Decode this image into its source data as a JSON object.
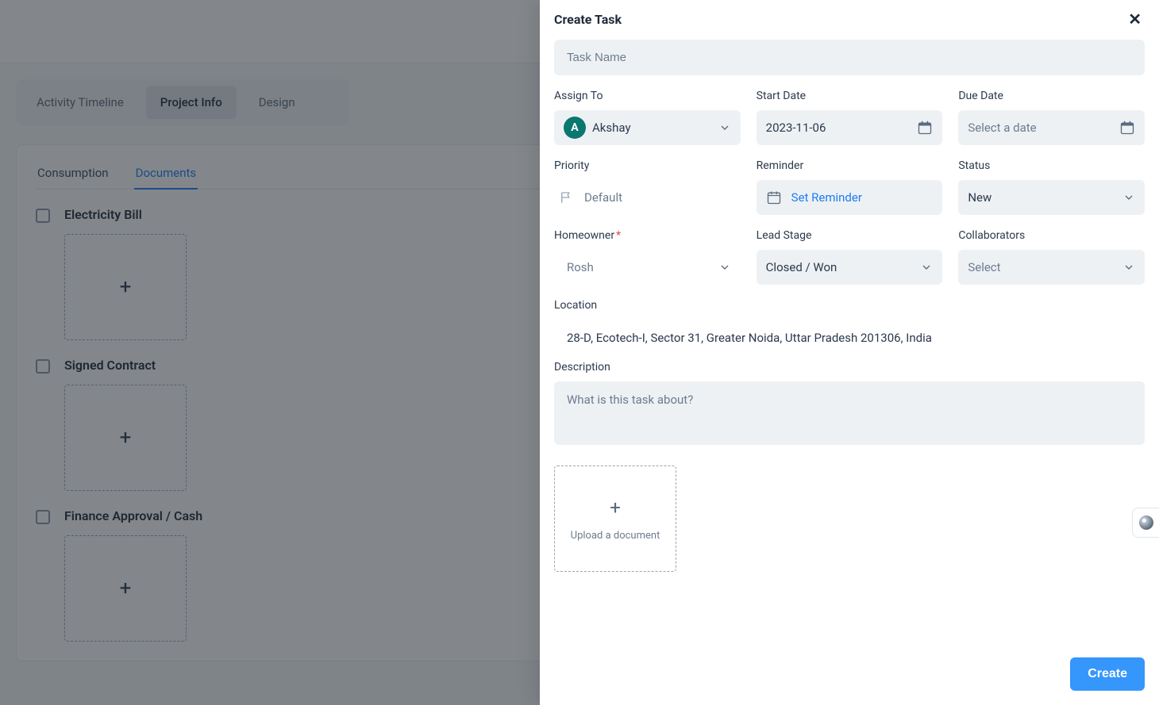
{
  "bg": {
    "tabs": [
      {
        "label": "Activity Timeline",
        "active": false
      },
      {
        "label": "Project Info",
        "active": true
      },
      {
        "label": "Design",
        "active": false
      }
    ],
    "subtabs": [
      {
        "label": "Consumption",
        "active": false
      },
      {
        "label": "Documents",
        "active": true
      }
    ],
    "docs": [
      {
        "title": "Electricity Bill"
      },
      {
        "title": "Signed Contract"
      },
      {
        "title": "Finance Approval / Cash"
      }
    ]
  },
  "drawer": {
    "title": "Create Task",
    "task_name_placeholder": "Task Name",
    "labels": {
      "assign_to": "Assign To",
      "start_date": "Start Date",
      "due_date": "Due Date",
      "priority": "Priority",
      "reminder": "Reminder",
      "status": "Status",
      "homeowner": "Homeowner",
      "lead_stage": "Lead Stage",
      "collaborators": "Collaborators",
      "location": "Location",
      "description": "Description"
    },
    "assignee": {
      "initial": "A",
      "name": "Akshay"
    },
    "start_date_value": "2023-11-06",
    "due_date_placeholder": "Select a date",
    "priority_value": "Default",
    "reminder_action": "Set Reminder",
    "status_value": "New",
    "homeowner_value": "Rosh",
    "lead_stage_value": "Closed / Won",
    "collaborators_placeholder": "Select",
    "location_value": "28-D, Ecotech-I, Sector 31, Greater Noida, Uttar Pradesh 201306, India",
    "description_placeholder": "What is this task about?",
    "upload_label": "Upload a document",
    "create_button": "Create"
  }
}
